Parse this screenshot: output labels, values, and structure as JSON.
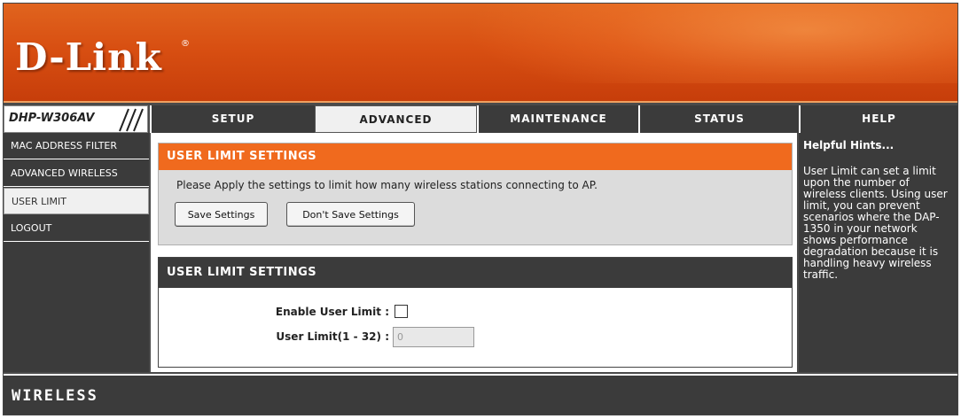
{
  "banner": {
    "logo": "D-Link",
    "registered": "®"
  },
  "nav": {
    "model": "DHP-W306AV",
    "tabs": [
      {
        "label": "SETUP",
        "active": false
      },
      {
        "label": "ADVANCED",
        "active": true
      },
      {
        "label": "MAINTENANCE",
        "active": false
      },
      {
        "label": "STATUS",
        "active": false
      },
      {
        "label": "HELP",
        "active": false
      }
    ]
  },
  "sidebar": {
    "items": [
      {
        "label": "MAC ADDRESS FILTER",
        "active": false
      },
      {
        "label": "ADVANCED WIRELESS",
        "active": false
      },
      {
        "label": "USER LIMIT",
        "active": true
      },
      {
        "label": "LOGOUT",
        "active": false
      }
    ]
  },
  "main": {
    "intro": {
      "title": "USER LIMIT SETTINGS",
      "description": "Please Apply the settings to limit how many wireless stations connecting to AP.",
      "save_label": "Save Settings",
      "dont_save_label": "Don't Save Settings"
    },
    "settings": {
      "title": "USER LIMIT SETTINGS",
      "enable_label": "Enable User Limit :",
      "enable_checked": false,
      "limit_label": "User Limit(1 - 32) :",
      "limit_value": "0"
    }
  },
  "help": {
    "title": "Helpful Hints...",
    "text": "User Limit can set a limit upon the number of wireless clients. Using user limit, you can prevent scenarios where the DAP-1350 in your network shows performance degradation because it is handling heavy wireless traffic."
  },
  "footer": {
    "label": "WIRELESS"
  },
  "colors": {
    "orange": "#f06a1e",
    "dark": "#3b3b3b",
    "banner": "#d84f12"
  }
}
